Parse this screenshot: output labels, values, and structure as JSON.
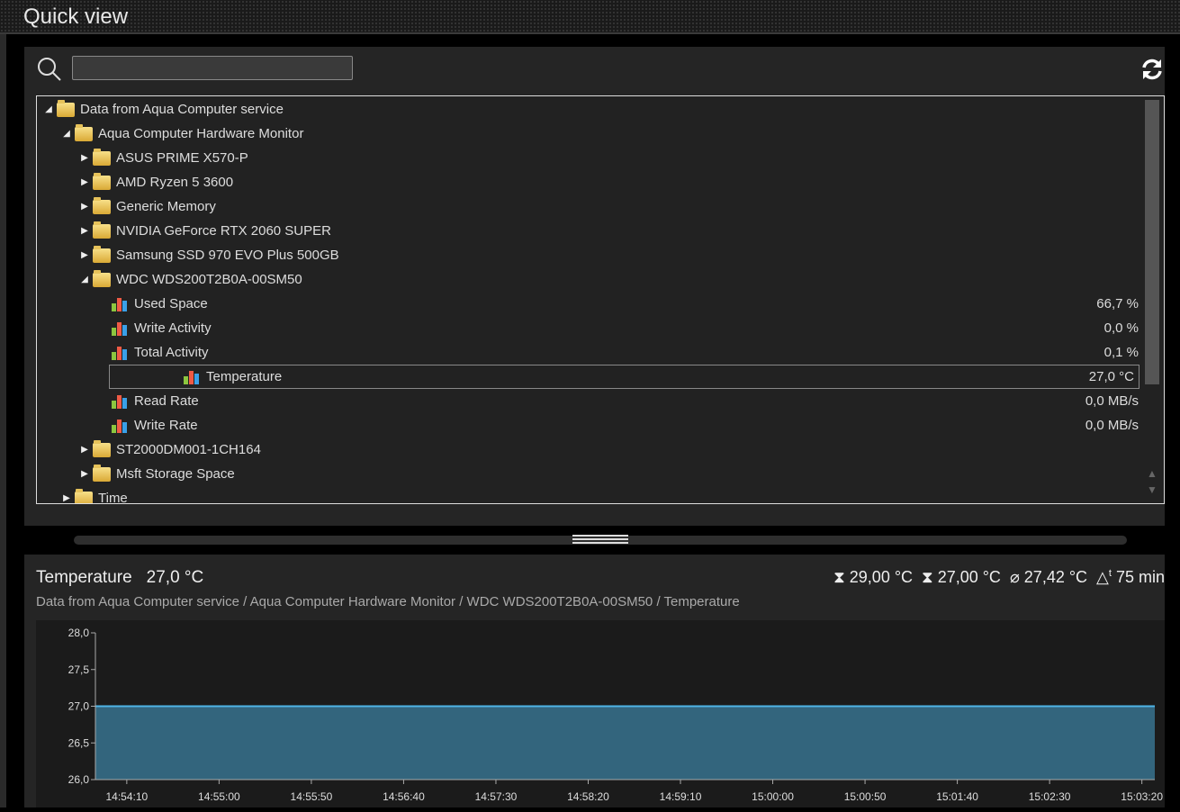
{
  "window": {
    "title": "Quick view"
  },
  "search": {
    "placeholder": "",
    "value": ""
  },
  "icons": {
    "search": "search-icon",
    "refresh": "refresh-icon",
    "folder": "folder-icon",
    "sensor": "bar-chart-icon"
  },
  "tree": [
    {
      "depth": 0,
      "type": "folder",
      "expanded": true,
      "label": "Data from Aqua Computer service",
      "value": ""
    },
    {
      "depth": 1,
      "type": "folder",
      "expanded": true,
      "label": "Aqua Computer Hardware Monitor",
      "value": ""
    },
    {
      "depth": 2,
      "type": "folder",
      "expanded": false,
      "label": "ASUS PRIME X570-P",
      "value": ""
    },
    {
      "depth": 2,
      "type": "folder",
      "expanded": false,
      "label": "AMD Ryzen 5 3600",
      "value": ""
    },
    {
      "depth": 2,
      "type": "folder",
      "expanded": false,
      "label": "Generic Memory",
      "value": ""
    },
    {
      "depth": 2,
      "type": "folder",
      "expanded": false,
      "label": "NVIDIA GeForce RTX 2060 SUPER",
      "value": ""
    },
    {
      "depth": 2,
      "type": "folder",
      "expanded": false,
      "label": "Samsung SSD 970 EVO Plus 500GB",
      "value": ""
    },
    {
      "depth": 2,
      "type": "folder",
      "expanded": true,
      "label": "WDC  WDS200T2B0A-00SM50",
      "value": ""
    },
    {
      "depth": 3,
      "type": "sensor",
      "label": "Used Space",
      "value": "66,7 %"
    },
    {
      "depth": 3,
      "type": "sensor",
      "label": "Write Activity",
      "value": "0,0 %"
    },
    {
      "depth": 3,
      "type": "sensor",
      "label": "Total Activity",
      "value": "0,1 %"
    },
    {
      "depth": 3,
      "type": "sensor",
      "label": "Temperature",
      "value": "27,0 °C",
      "selected": true
    },
    {
      "depth": 3,
      "type": "sensor",
      "label": "Read Rate",
      "value": "0,0 MB/s"
    },
    {
      "depth": 3,
      "type": "sensor",
      "label": "Write Rate",
      "value": "0,0 MB/s"
    },
    {
      "depth": 2,
      "type": "folder",
      "expanded": false,
      "label": "ST2000DM001-1CH164",
      "value": ""
    },
    {
      "depth": 2,
      "type": "folder",
      "expanded": false,
      "label": "Msft Storage Space",
      "value": ""
    },
    {
      "depth": 1,
      "type": "folder",
      "expanded": false,
      "label": "Time",
      "value": ""
    }
  ],
  "detail": {
    "name": "Temperature",
    "current": "27,0 °C",
    "max": "29,00 °C",
    "min": "27,00 °C",
    "avg": "27,42 °C",
    "duration": "75 min",
    "path": "Data from Aqua Computer service / Aqua Computer Hardware Monitor / WDC  WDS200T2B0A-00SM50 / Temperature"
  },
  "chart_data": {
    "type": "area",
    "title": "Temperature",
    "ylim": [
      26.0,
      28.0
    ],
    "yticks": [
      "28,0",
      "27,5",
      "27,0",
      "26,5",
      "26,0"
    ],
    "ytick_values": [
      28.0,
      27.5,
      27.0,
      26.5,
      26.0
    ],
    "xlim": [
      "14:53:53",
      "15:03:27"
    ],
    "xticks": [
      "14:54:10",
      "14:55:00",
      "14:55:50",
      "14:56:40",
      "14:57:30",
      "14:58:20",
      "14:59:10",
      "15:00:00",
      "15:00:50",
      "15:01:40",
      "15:02:30",
      "15:03:20"
    ],
    "x": [
      "14:53:53",
      "15:03:27"
    ],
    "values": [
      27.0,
      27.0
    ],
    "colors": {
      "line": "#4fb4e6",
      "fill": "#33657d"
    }
  }
}
